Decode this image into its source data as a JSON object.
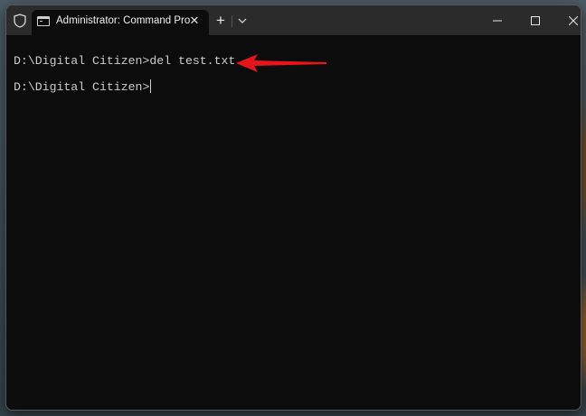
{
  "window": {
    "tab_title": "Administrator: Command Pro",
    "tab_icon": "terminal-icon",
    "new_tab_symbol": "+",
    "close_tab_symbol": "✕"
  },
  "terminal": {
    "lines": [
      {
        "prompt": "D:\\Digital Citizen>",
        "command": "del test.txt"
      },
      {
        "prompt": "D:\\Digital Citizen>",
        "command": ""
      }
    ]
  },
  "annotation": {
    "arrow_color": "#e8141c",
    "arrow_target": "del test.txt command"
  },
  "colors": {
    "titlebar": "#2b2b2b",
    "terminal_bg": "#0c0c0c",
    "terminal_text": "#cccccc"
  }
}
